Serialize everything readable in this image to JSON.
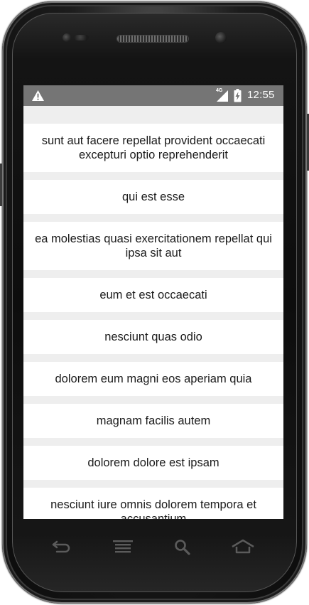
{
  "device": {
    "nav_icons": [
      "back-icon",
      "menu-icon",
      "search-icon",
      "home-icon"
    ]
  },
  "status_bar": {
    "warning_icon": "warning-icon",
    "network_type": "4G",
    "battery_icon": "battery-charging-icon",
    "time": "12:55",
    "background_color": "#757575"
  },
  "list": {
    "background_color": "#eeeeee",
    "card_color": "#ffffff",
    "items": [
      {
        "title": "sunt aut facere repellat provident occaecati excepturi optio reprehenderit"
      },
      {
        "title": "qui est esse"
      },
      {
        "title": "ea molestias quasi exercitationem repellat qui ipsa sit aut"
      },
      {
        "title": "eum et est occaecati"
      },
      {
        "title": "nesciunt quas odio"
      },
      {
        "title": "dolorem eum magni eos aperiam quia"
      },
      {
        "title": "magnam facilis autem"
      },
      {
        "title": "dolorem dolore est ipsam"
      },
      {
        "title": "nesciunt iure omnis dolorem tempora et accusantium"
      }
    ]
  }
}
